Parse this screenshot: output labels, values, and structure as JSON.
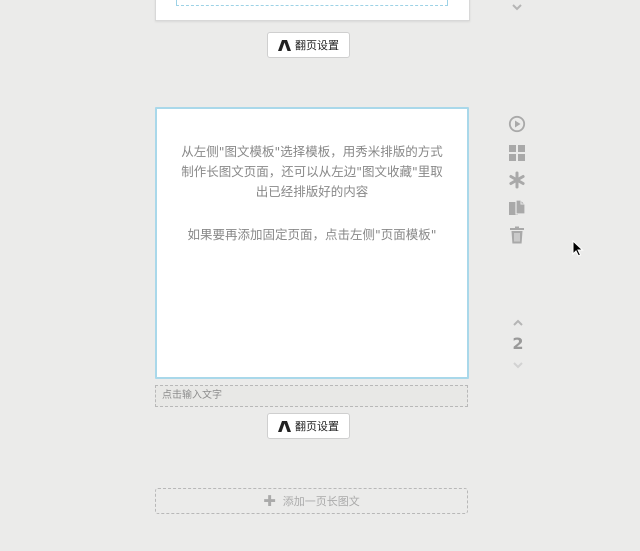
{
  "previous_page": {
    "flip_settings_label": "翻页设置"
  },
  "current_page": {
    "hint_line1": "从左侧\"图文模板\"选择模板，用秀米排版的方式制作长图文页面，还可以从左边\"图文收藏\"里取出已经排版好的内容",
    "hint_line2": "如果要再添加固定页面，点击左侧\"页面模板\"",
    "caption_placeholder": "点击输入文字",
    "flip_settings_label": "翻页设置",
    "page_number": "2"
  },
  "add_page_label": "添加一页长图文",
  "toolbar_icons": [
    "play-icon",
    "grid-layout-icon",
    "asterisk-icon",
    "copy-icon",
    "trash-icon"
  ],
  "colors": {
    "background": "#ebebea",
    "selected_border": "#a9d8ea",
    "icon_gray": "#a9a9a9",
    "hint_text": "#888888"
  }
}
